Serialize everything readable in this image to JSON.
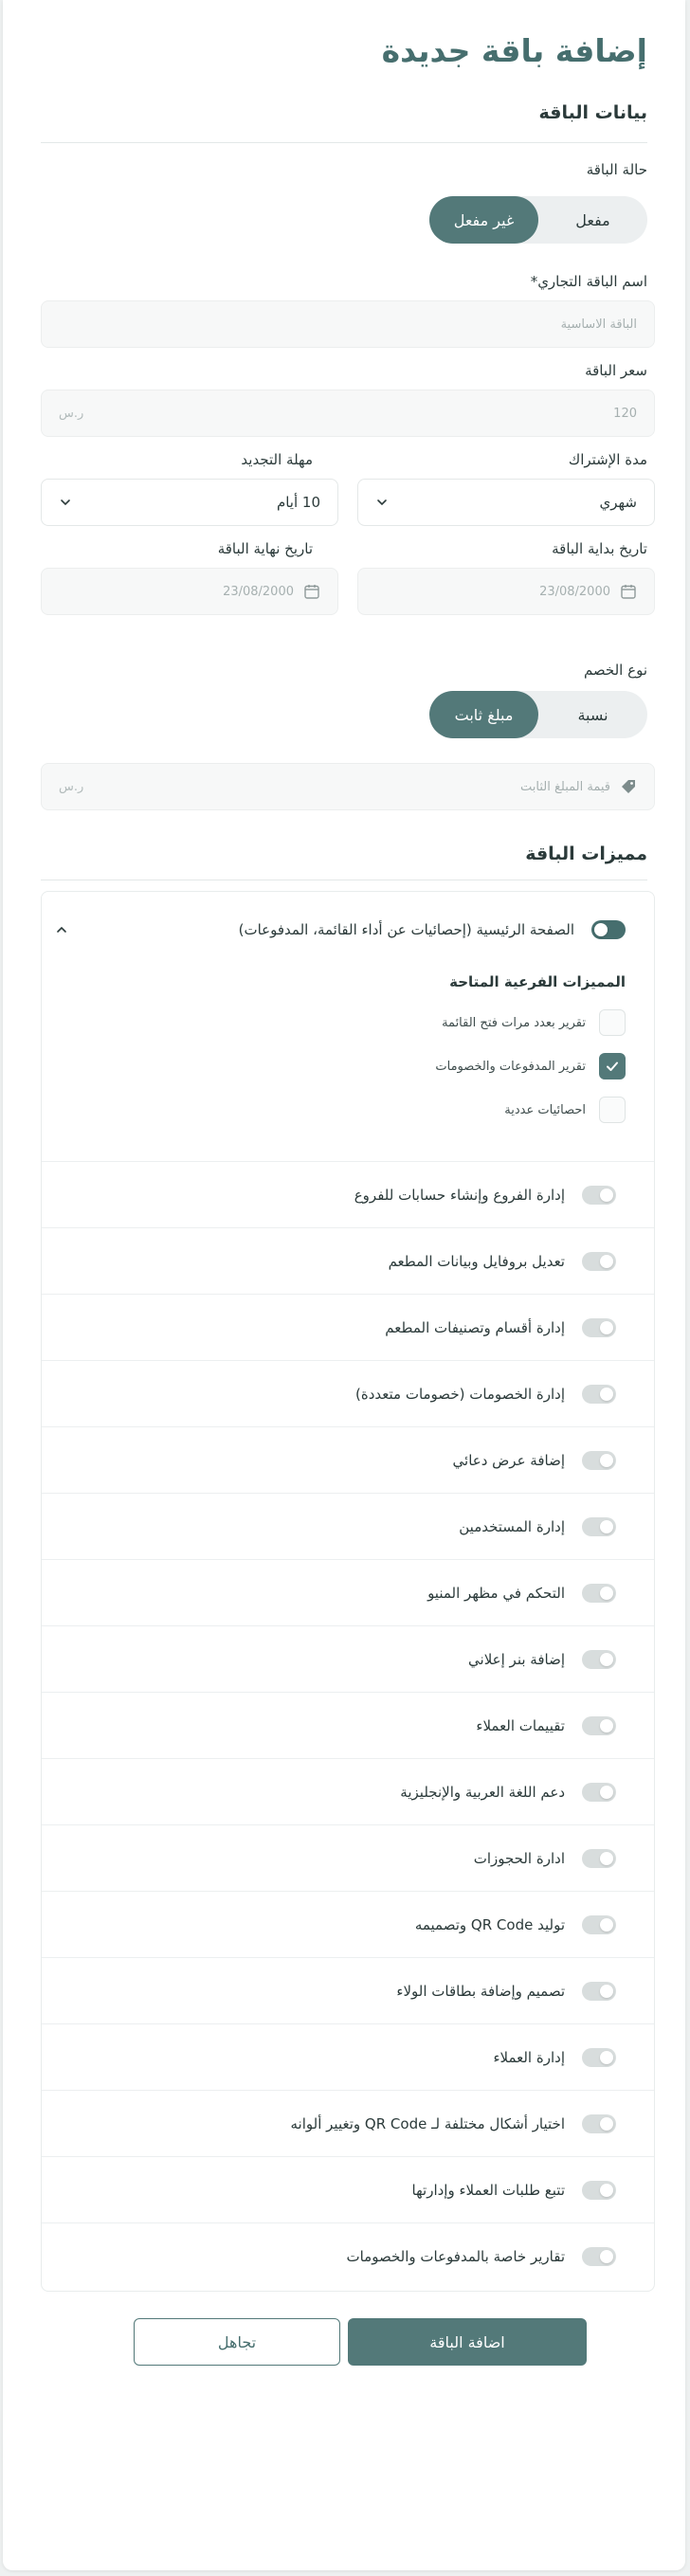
{
  "page_title": "إضافة باقة جديدة",
  "section_plan_data": "بيانات الباقة",
  "plan_status": {
    "label": "حالة الباقة",
    "options": [
      "مفعل",
      "غير مفعل"
    ],
    "selected": "غير مفعل"
  },
  "trade_name": {
    "label": "اسم الباقة التجاري*",
    "placeholder": "الباقة الاساسية"
  },
  "price": {
    "label": "سعر الباقة",
    "placeholder": "120",
    "currency": "ر.س"
  },
  "subscription_period": {
    "label": "مدة الإشتراك",
    "value": "شهري"
  },
  "renewal_grace": {
    "label": "مهلة التجديد",
    "value": "10 أيام"
  },
  "start_date": {
    "label": "تاريخ بداية الباقة",
    "placeholder": "23/08/2000"
  },
  "end_date": {
    "label": "تاريخ نهاية الباقة",
    "placeholder": "23/08/2000"
  },
  "discount_type": {
    "label": "نوع الخصم",
    "options": [
      "نسبة",
      "مبلغ ثابت"
    ],
    "selected": "مبلغ ثابت"
  },
  "fixed_amount": {
    "placeholder": "قيمة المبلغ الثابت",
    "currency": "ر.س"
  },
  "section_features": "مميزات الباقة",
  "main_feature": {
    "label": "الصفحة الرئيسية (إحصائيات عن أداء القائمة، المدفوعات)",
    "enabled": true,
    "sub_title": "المميزات الفرعية المتاحة",
    "sub_features": [
      {
        "label": "تقرير بعدد مرات فتح القائمة",
        "checked": false
      },
      {
        "label": "تقرير المدفوعات والخصومات",
        "checked": true
      },
      {
        "label": "احصائيات عددية",
        "checked": false
      }
    ]
  },
  "features": [
    {
      "label": "إدارة الفروع وإنشاء حسابات للفروع",
      "enabled": false
    },
    {
      "label": "تعديل بروفايل وبيانات المطعم",
      "enabled": false
    },
    {
      "label": "إدارة أقسام وتصنيفات المطعم",
      "enabled": false
    },
    {
      "label": "إدارة الخصومات (خصومات متعددة)",
      "enabled": false
    },
    {
      "label": "إضافة عرض دعائي",
      "enabled": false
    },
    {
      "label": "إدارة المستخدمين",
      "enabled": false
    },
    {
      "label": "التحكم في مظهر المنيو",
      "enabled": false
    },
    {
      "label": "إضافة بنر إعلاني",
      "enabled": false
    },
    {
      "label": "تقييمات العملاء",
      "enabled": false
    },
    {
      "label": "دعم اللغة العربية والإنجليزية",
      "enabled": false
    },
    {
      "label": "ادارة الحجوزات",
      "enabled": false
    },
    {
      "label": "توليد QR Code وتصميمه",
      "enabled": false
    },
    {
      "label": "تصميم وإضافة بطاقات الولاء",
      "enabled": false
    },
    {
      "label": "إدارة العملاء",
      "enabled": false
    },
    {
      "label": "اختيار أشكال مختلفة لـ QR Code وتغيير ألوانه",
      "enabled": false
    },
    {
      "label": "تتبع طلبات العملاء وإدارتها",
      "enabled": false
    },
    {
      "label": "تقارير خاصة بالمدفوعات والخصومات",
      "enabled": false
    }
  ],
  "buttons": {
    "submit": "اضافة الباقة",
    "cancel": "تجاهل"
  },
  "colors": {
    "accent": "#537979",
    "title": "#466e6e"
  }
}
